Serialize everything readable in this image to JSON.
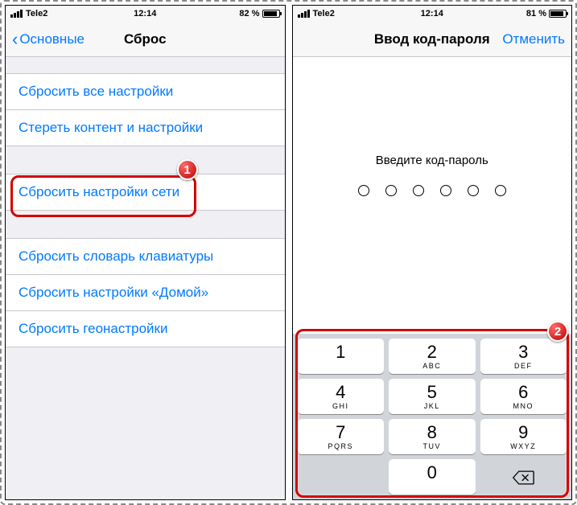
{
  "left": {
    "status": {
      "carrier": "Tele2",
      "time": "12:14",
      "battery_pct": "82 %",
      "battery_fill": 82
    },
    "nav": {
      "back": "Основные",
      "title": "Сброс"
    },
    "group1": [
      "Сбросить все настройки",
      "Стереть контент и настройки"
    ],
    "group2": [
      "Сбросить настройки сети"
    ],
    "group3": [
      "Сбросить словарь клавиатуры",
      "Сбросить настройки «Домой»",
      "Сбросить геонастройки"
    ],
    "badge": "1"
  },
  "right": {
    "status": {
      "carrier": "Tele2",
      "time": "12:14",
      "battery_pct": "81 %",
      "battery_fill": 81
    },
    "nav": {
      "title": "Ввод код-пароля",
      "cancel": "Отменить"
    },
    "prompt": "Введите код-пароль",
    "passcode_length": 6,
    "keys": [
      [
        {
          "d": "1",
          "l": ""
        },
        {
          "d": "2",
          "l": "ABC"
        },
        {
          "d": "3",
          "l": "DEF"
        }
      ],
      [
        {
          "d": "4",
          "l": "GHI"
        },
        {
          "d": "5",
          "l": "JKL"
        },
        {
          "d": "6",
          "l": "MNO"
        }
      ],
      [
        {
          "d": "7",
          "l": "PQRS"
        },
        {
          "d": "8",
          "l": "TUV"
        },
        {
          "d": "9",
          "l": "WXYZ"
        }
      ]
    ],
    "zero": {
      "d": "0",
      "l": ""
    },
    "badge": "2"
  }
}
